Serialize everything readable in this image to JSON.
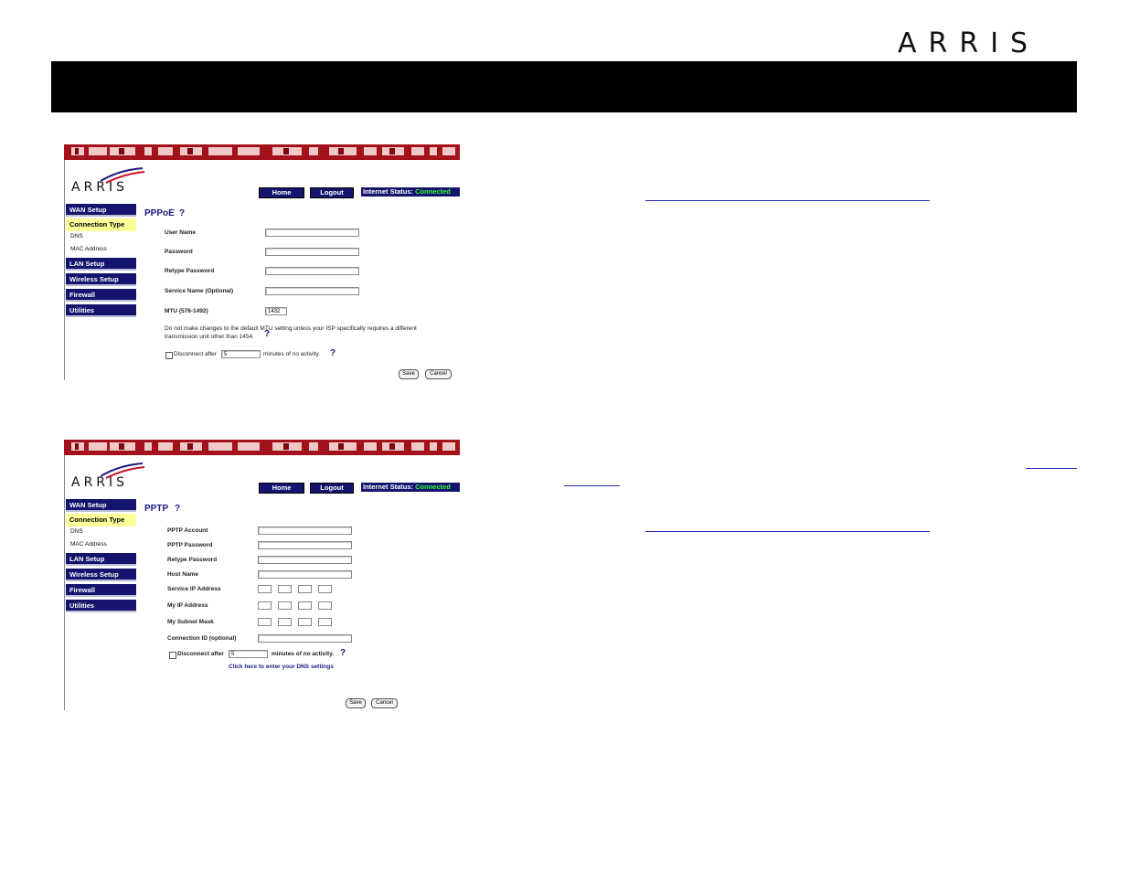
{
  "brand": {
    "logo_text": "ARRIS"
  },
  "pppoe": {
    "mini_logo": "ARRIS",
    "nav": {
      "home": "Home",
      "logout": "Logout",
      "status_label": "Internet Status:",
      "status_value": "Connected"
    },
    "sidebar": {
      "wan_setup": "WAN Setup",
      "connection_type": "Connection Type",
      "dns": "DNS",
      "mac_address": "MAC Address",
      "lan_setup": "LAN Setup",
      "wireless_setup": "Wireless Setup",
      "firewall": "Firewall",
      "utilities": "Utilities"
    },
    "heading": "PPPoE",
    "help": "?",
    "fields": {
      "user_name": "User Name",
      "password": "Password",
      "retype_password": "Retype Password",
      "service_name": "Service Name (Optional)",
      "mtu_label": "MTU (576-1492)",
      "mtu_value": "1432"
    },
    "note_line1": "Do not make changes to the default MTU setting unless your ISP specifically requires a different",
    "note_line2": "transmission unit other than 1454.",
    "disconnect_label": "Disconnect after",
    "disconnect_value": "5",
    "disconnect_suffix": "minutes of no activity.",
    "save": "Save",
    "cancel": "Cancel"
  },
  "pptp": {
    "mini_logo": "ARRIS",
    "nav": {
      "home": "Home",
      "logout": "Logout",
      "status_label": "Internet Status:",
      "status_value": "Connected"
    },
    "sidebar": {
      "wan_setup": "WAN Setup",
      "connection_type": "Connection Type",
      "dns": "DNS",
      "mac_address": "MAC Address",
      "lan_setup": "LAN Setup",
      "wireless_setup": "Wireless Setup",
      "firewall": "Firewall",
      "utilities": "Utilities"
    },
    "heading": "PPTP",
    "help": "?",
    "fields": {
      "pptp_account": "PPTP Account",
      "pptp_password": "PPTP Password",
      "retype_password": "Retype Password",
      "host_name": "Host Name",
      "service_ip": "Service IP Address",
      "my_ip": "My IP Address",
      "subnet_mask": "My Subnet Mask",
      "connection_id": "Connection ID (optional)"
    },
    "disconnect_label": "Disconnect after",
    "disconnect_value": "5",
    "disconnect_suffix": "minutes of no activity.",
    "dns_link": "Click here to enter your DNS settings",
    "save": "Save",
    "cancel": "Cancel"
  },
  "colors": {
    "header_bar": "#000000",
    "stripe": "#a3111b",
    "nav_blue": "#14146e",
    "status_green": "#33ff33",
    "highlight": "#ffff99",
    "link_blue": "#2a2ab0"
  }
}
